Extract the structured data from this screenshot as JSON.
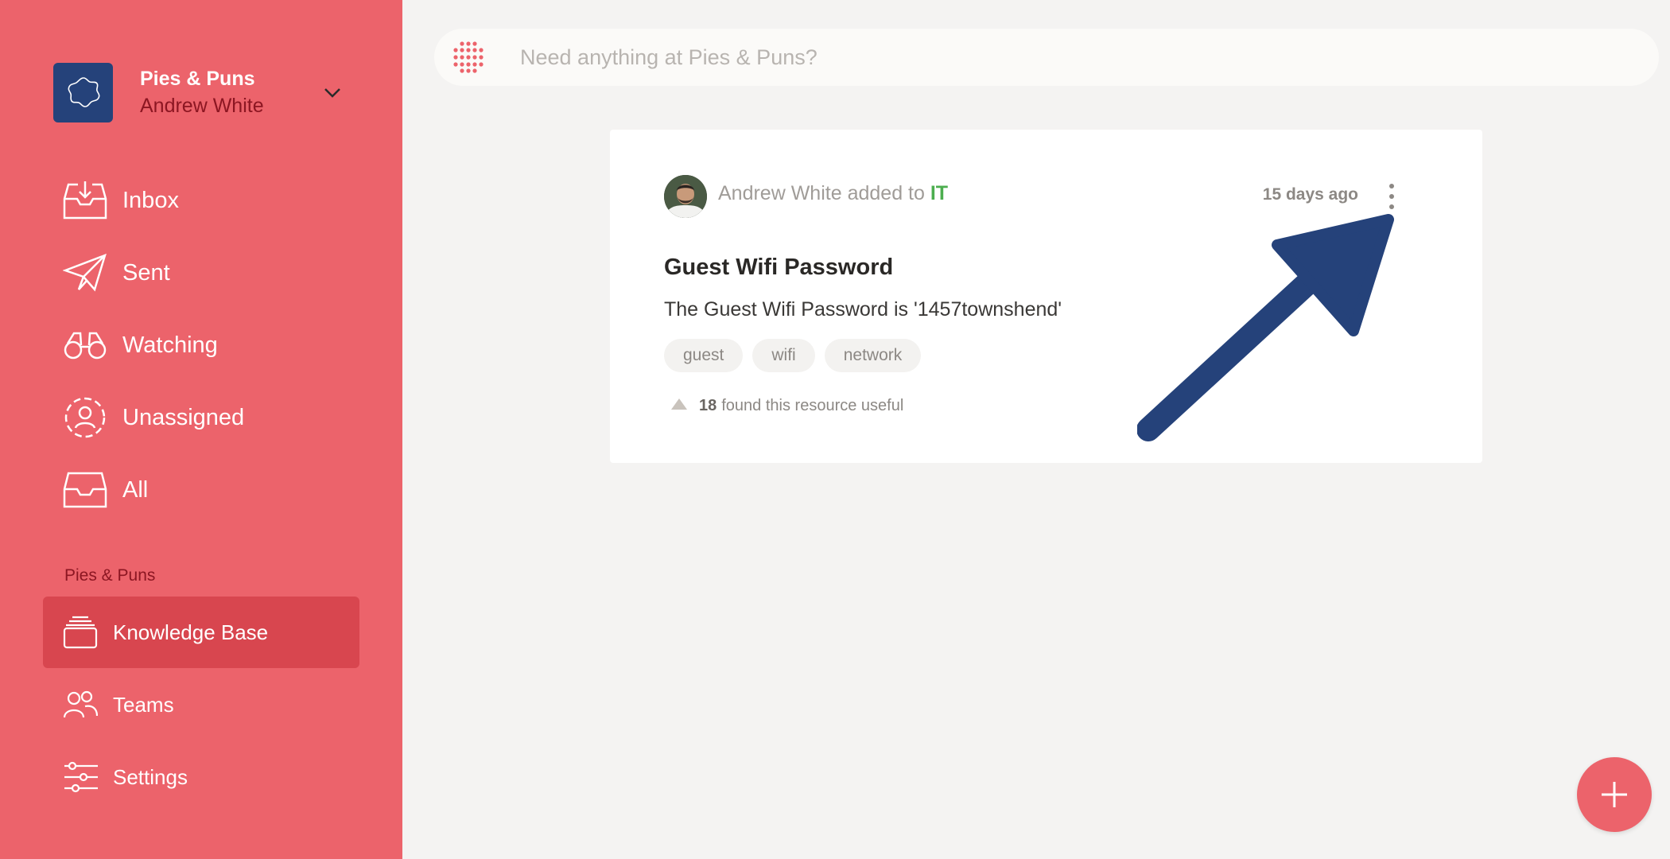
{
  "workspace": {
    "name": "Pies & Puns",
    "user": "Andrew White"
  },
  "nav": [
    {
      "id": "inbox",
      "label": "Inbox",
      "icon": "inbox-icon"
    },
    {
      "id": "sent",
      "label": "Sent",
      "icon": "paper-plane-icon"
    },
    {
      "id": "watching",
      "label": "Watching",
      "icon": "binoculars-icon"
    },
    {
      "id": "unassigned",
      "label": "Unassigned",
      "icon": "unassigned-user-icon"
    },
    {
      "id": "all",
      "label": "All",
      "icon": "tray-icon"
    }
  ],
  "section": {
    "title": "Pies & Puns",
    "items": [
      {
        "id": "knowledge-base",
        "label": "Knowledge Base",
        "icon": "stack-icon",
        "active": true
      },
      {
        "id": "teams",
        "label": "Teams",
        "icon": "people-icon"
      },
      {
        "id": "settings",
        "label": "Settings",
        "icon": "sliders-icon"
      }
    ]
  },
  "search": {
    "placeholder": "Need anything at Pies & Puns?"
  },
  "card": {
    "author": "Andrew White",
    "action": "added to",
    "team": "IT",
    "time": "15 days ago",
    "title": "Guest Wifi Password",
    "body": "The Guest Wifi Password is '1457townshend'",
    "tags": [
      "guest",
      "wifi",
      "network"
    ],
    "useful_count": "18",
    "useful_text": "found this resource useful"
  },
  "colors": {
    "sidebar": "#ec636b",
    "active": "#d8464f",
    "accent_dark": "#8c1622",
    "arrow": "#25427a",
    "team": "#4cae4f"
  }
}
